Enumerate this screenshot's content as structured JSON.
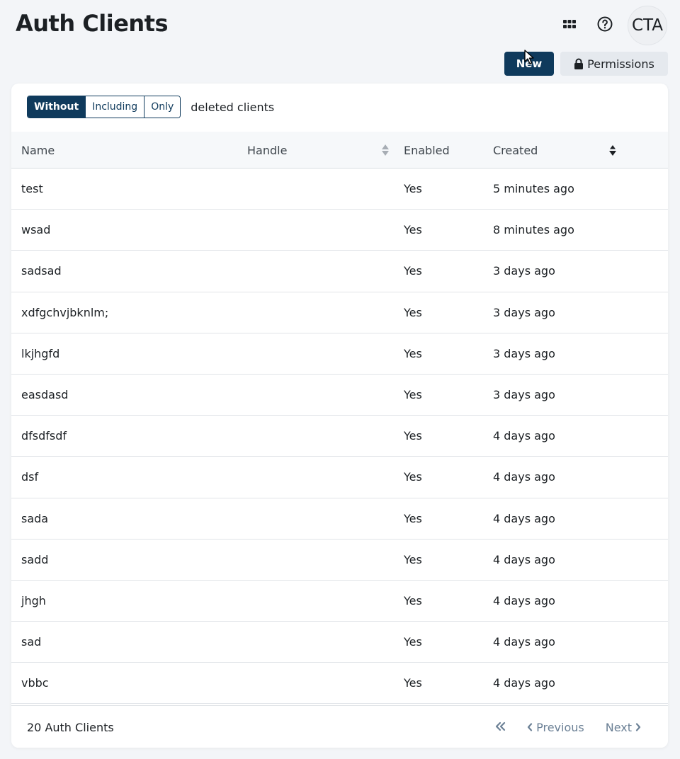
{
  "header": {
    "title": "Auth Clients",
    "apps_icon": "grid-icon",
    "help_icon": "help-circle-icon",
    "avatar_initials": "CTA"
  },
  "actions": {
    "new_label": "New",
    "permissions_label": "Permissions",
    "permissions_icon": "lock-icon"
  },
  "filter": {
    "options": [
      "Without",
      "Including",
      "Only"
    ],
    "selected": "Without",
    "suffix": "deleted clients"
  },
  "table": {
    "columns": {
      "name": "Name",
      "handle": "Handle",
      "enabled": "Enabled",
      "created": "Created"
    },
    "sorted_column": "Created",
    "sort_direction": "descending",
    "rows": [
      {
        "name": "test",
        "handle": "",
        "enabled": "Yes",
        "created": "5 minutes ago"
      },
      {
        "name": "wsad",
        "handle": "",
        "enabled": "Yes",
        "created": "8 minutes ago"
      },
      {
        "name": "sadsad",
        "handle": "",
        "enabled": "Yes",
        "created": "3 days ago"
      },
      {
        "name": "xdfgchvjbknlm;",
        "handle": "",
        "enabled": "Yes",
        "created": "3 days ago"
      },
      {
        "name": "lkjhgfd",
        "handle": "",
        "enabled": "Yes",
        "created": "3 days ago"
      },
      {
        "name": "easdasd",
        "handle": "",
        "enabled": "Yes",
        "created": "3 days ago"
      },
      {
        "name": "dfsdfsdf",
        "handle": "",
        "enabled": "Yes",
        "created": "4 days ago"
      },
      {
        "name": "dsf",
        "handle": "",
        "enabled": "Yes",
        "created": "4 days ago"
      },
      {
        "name": "sada",
        "handle": "",
        "enabled": "Yes",
        "created": "4 days ago"
      },
      {
        "name": "sadd",
        "handle": "",
        "enabled": "Yes",
        "created": "4 days ago"
      },
      {
        "name": "jhgh",
        "handle": "",
        "enabled": "Yes",
        "created": "4 days ago"
      },
      {
        "name": "sad",
        "handle": "",
        "enabled": "Yes",
        "created": "4 days ago"
      },
      {
        "name": "vbbc",
        "handle": "",
        "enabled": "Yes",
        "created": "4 days ago"
      }
    ]
  },
  "footer": {
    "count_label": "20 Auth Clients",
    "first_icon": "double-chevron-left-icon",
    "previous_label": "Previous",
    "next_label": "Next"
  },
  "colors": {
    "primary": "#0f3a5c",
    "secondary_button": "#e5e9ee",
    "pager_text": "#6c8196"
  }
}
